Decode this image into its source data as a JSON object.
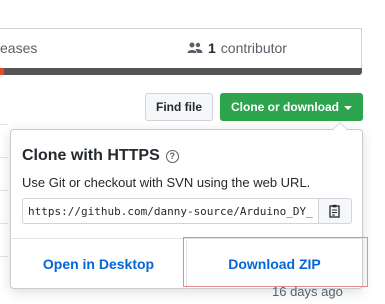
{
  "stats": {
    "releases_label": "eases",
    "contributor_count": "1",
    "contributor_label": "contributor"
  },
  "toolbar": {
    "find_file_label": "Find file",
    "clone_label": "Clone or download"
  },
  "clone_popover": {
    "title": "Clone with HTTPS",
    "help_glyph": "?",
    "description": "Use Git or checkout with SVN using the web URL.",
    "url_value": "https://github.com/danny-source/Arduino_DY_IRDaikin.git",
    "copy_icon": "clipboard-icon",
    "open_desktop_label": "Open in Desktop",
    "download_zip_label": "Download ZIP"
  },
  "commit_info": {
    "timestamp": "16 days ago"
  },
  "colors": {
    "accent_green": "#2ea44f",
    "link_blue": "#0366d6",
    "highlight_red": "#e8898d"
  }
}
